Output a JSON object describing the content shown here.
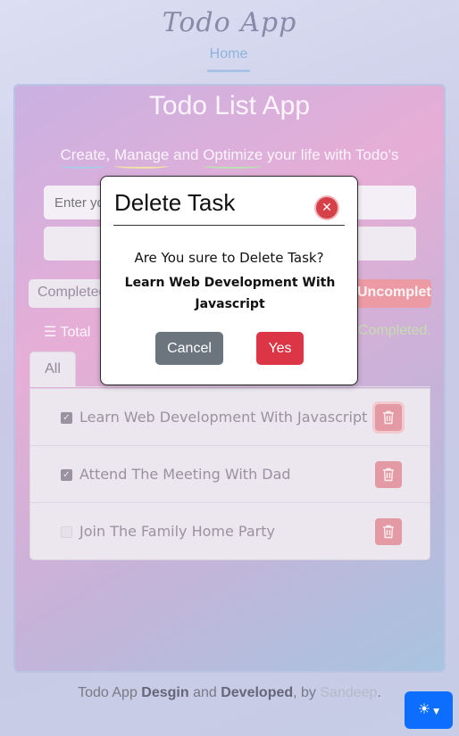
{
  "header": {
    "logo": "Todo App",
    "nav_home": "Home"
  },
  "card": {
    "title": "Todo List App",
    "tagline": {
      "w1": "Create",
      "s1": ", ",
      "w2": "Manage",
      "s2": " and ",
      "w3": "Optimize",
      "s3": " your life with Todo's"
    },
    "input_placeholder": "Enter your task",
    "filter_completed": "Completed",
    "filter_uncompleted": "Uncompleted",
    "stats_total": "Total",
    "stats_completed": "Completed."
  },
  "tabs": {
    "all": "All"
  },
  "tasks": [
    {
      "text": "Learn Web Development With Javascript",
      "checked": true
    },
    {
      "text": "Attend The Meeting With Dad",
      "checked": true
    },
    {
      "text": "Join The Family Home Party",
      "checked": false
    }
  ],
  "modal": {
    "title": "Delete Task",
    "question": "Are You sure to Delete Task?",
    "task_name": "Learn Web Development With Javascript",
    "cancel": "Cancel",
    "yes": "Yes"
  },
  "footer": {
    "prefix": "Todo App ",
    "design": "Desgin",
    "and": " and ",
    "developed": "Developed",
    "by": ", by ",
    "author": "Sandeep",
    "end": "."
  },
  "icons": {
    "theme": "sun-icon",
    "delete": "trash-icon",
    "list": "list-check-icon",
    "close": "close-icon"
  },
  "colors": {
    "primary": "#0d6efd",
    "danger": "#dc3545",
    "secondary": "#6c757d"
  }
}
